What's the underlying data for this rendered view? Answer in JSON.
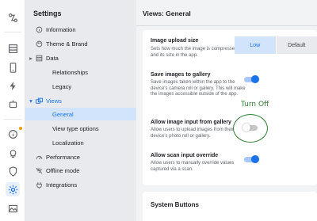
{
  "rail": {
    "icons": [
      "automation-icon",
      "table-icon",
      "phone-icon",
      "bolt-icon",
      "robot-icon",
      "info-icon",
      "lightbulb-icon",
      "security-icon",
      "settings-icon",
      "image-icon"
    ]
  },
  "nav": {
    "title": "Settings",
    "items": [
      {
        "label": "Information"
      },
      {
        "label": "Theme & Brand"
      },
      {
        "label": "Data"
      },
      {
        "label": "Relationships"
      },
      {
        "label": "Legacy"
      },
      {
        "label": "Views"
      },
      {
        "label": "General"
      },
      {
        "label": "View type options"
      },
      {
        "label": "Localization"
      },
      {
        "label": "Performance"
      },
      {
        "label": "Offline mode"
      },
      {
        "label": "Integrations"
      }
    ]
  },
  "main": {
    "title": "Views: General",
    "settings": [
      {
        "label": "Image upload size",
        "desc": "Sets how much the image is compressed and its size in the app."
      },
      {
        "label": "Save images to gallery",
        "desc": "Save images taken within the app to the device's camera roll or gallery. This will make the images accessible outside of the app.",
        "enabled": true
      },
      {
        "label": "Allow image input from gallery",
        "desc": "Allow users to upload images from their device's photo roll or gallery.",
        "enabled": false
      },
      {
        "label": "Allow scan input override",
        "desc": "Allow users to manually override values captured via a scan.",
        "enabled": true
      }
    ],
    "upload_size_options": [
      "Low",
      "Default"
    ],
    "upload_size_selected": "Low",
    "system_buttons_title": "System Buttons"
  },
  "annotation": {
    "text": "Turn Off",
    "color": "#2e7d32"
  },
  "colors": {
    "accent": "#1a73e8",
    "selected_bg": "#d2e3fc"
  }
}
